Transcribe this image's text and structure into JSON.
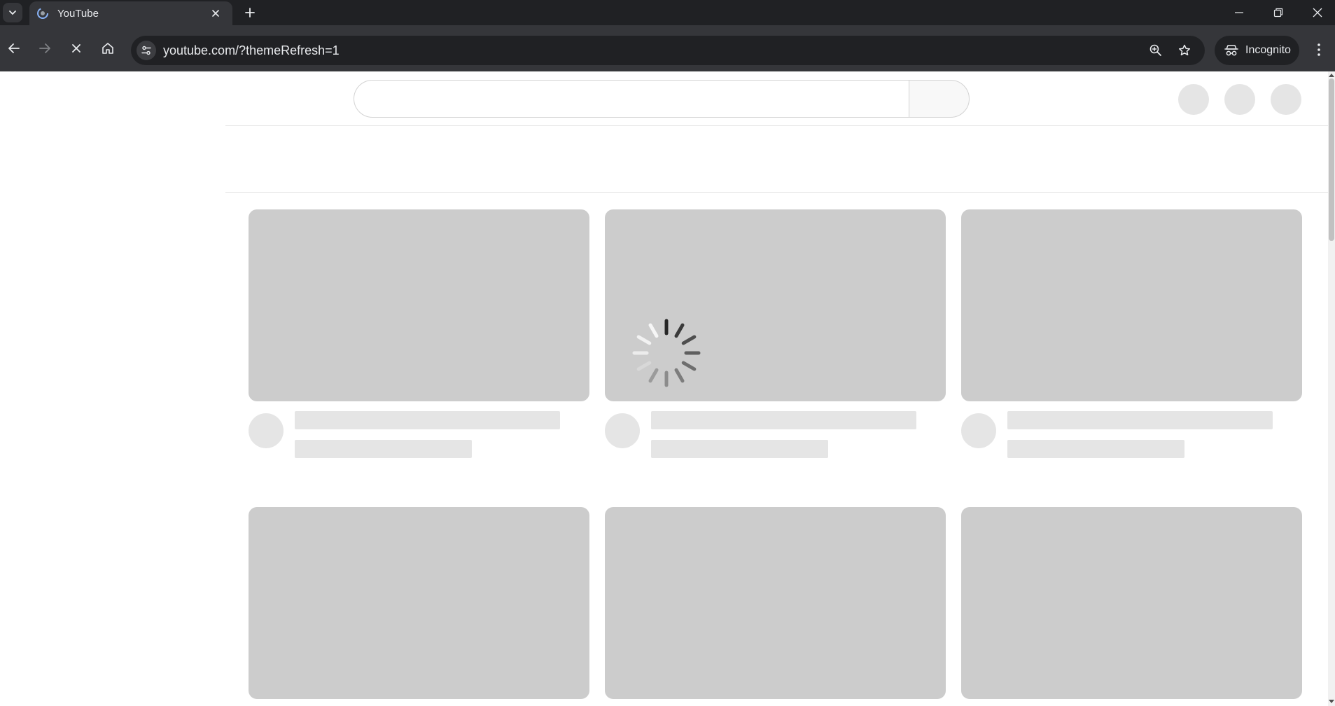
{
  "browser": {
    "tab": {
      "title": "YouTube"
    },
    "address_bar": {
      "url": "youtube.com/?themeRefresh=1"
    },
    "profile": {
      "label": "Incognito"
    },
    "colors": {
      "chrome_dark": "#202124",
      "chrome_toolbar": "#35363a",
      "text": "#e8eaed"
    }
  },
  "page": {
    "state": "loading",
    "skeleton_color": "#cccccc",
    "skeleton_light": "#e5e5e5",
    "video_grid": {
      "columns": 3,
      "placeholder_cards": 6
    }
  },
  "icons": [
    "tab-search-chevron-icon",
    "youtube-loading-favicon-icon",
    "tab-close-icon",
    "new-tab-plus-icon",
    "minimize-icon",
    "restore-icon",
    "window-close-icon",
    "back-arrow-icon",
    "forward-arrow-icon",
    "stop-loading-icon",
    "home-icon",
    "site-info-tune-icon",
    "zoom-icon",
    "bookmark-star-icon",
    "incognito-icon",
    "kebab-menu-icon",
    "loading-spinner-icon"
  ]
}
